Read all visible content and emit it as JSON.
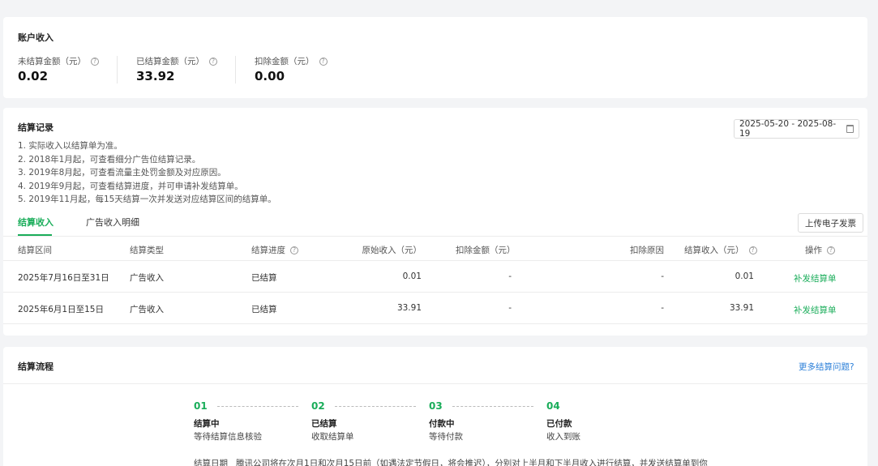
{
  "account": {
    "title": "账户收入",
    "metrics": [
      {
        "label": "未结算金额（元）",
        "value": "0.02"
      },
      {
        "label": "已结算金额（元）",
        "value": "33.92"
      },
      {
        "label": "扣除金额（元）",
        "value": "0.00"
      }
    ]
  },
  "settlement": {
    "title": "结算记录",
    "notes": [
      "1. 实际收入以结算单为准。",
      "2. 2018年1月起，可查看细分广告位结算记录。",
      "3. 2019年8月起，可查看流量主处罚金额及对应原因。",
      "4. 2019年9月起，可查看结算进度，并可申请补发结算单。",
      "5. 2019年11月起，每15天结算一次并发送对应结算区间的结算单。"
    ],
    "date_range": "2025-05-20 - 2025-08-19",
    "tabs": [
      "结算收入",
      "广告收入明细"
    ],
    "upload_button": "上传电子发票",
    "table": {
      "headers": [
        "结算区间",
        "结算类型",
        "结算进度",
        "原始收入（元）",
        "扣除金额（元）",
        "扣除原因",
        "结算收入（元）",
        "操作"
      ],
      "rows": [
        {
          "period": "2025年7月16日至31日",
          "type": "广告收入",
          "progress": "已结算",
          "original": "0.01",
          "deduction": "-",
          "reason": "-",
          "income": "0.01",
          "action": "补发结算单"
        },
        {
          "period": "2025年6月1日至15日",
          "type": "广告收入",
          "progress": "已结算",
          "original": "33.91",
          "deduction": "-",
          "reason": "-",
          "income": "33.91",
          "action": "补发结算单"
        }
      ]
    }
  },
  "flow": {
    "title": "结算流程",
    "help_link": "更多结算问题?",
    "steps": [
      {
        "num": "01",
        "title": "结算中",
        "desc": "等待结算信息核验"
      },
      {
        "num": "02",
        "title": "已结算",
        "desc": "收取结算单"
      },
      {
        "num": "03",
        "title": "付款中",
        "desc": "等待付款"
      },
      {
        "num": "04",
        "title": "已付款",
        "desc": "收入到账"
      }
    ],
    "footer_label": "结算日期",
    "footer_text": "腾讯公司将在次月1日和次月15日前（如遇法定节假日，将会推迟），分别对上半月和下半月收入进行结算，并发送结算单到你"
  },
  "colors": {
    "accent": "#1aad5a",
    "link": "#2b7fd8",
    "background": "#f3f4f6"
  },
  "icons": {
    "help": "question-circle-icon",
    "calendar": "calendar-icon"
  }
}
